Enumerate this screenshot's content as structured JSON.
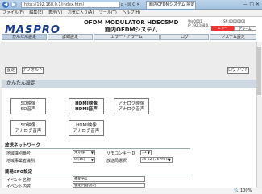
{
  "browser": {
    "back_icon": "back-arrow-icon",
    "forward_icon": "forward-arrow-icon",
    "address": "http://192.168.0.1/index.html",
    "address_controls": "ρ - ☒ C ✕",
    "tab_title": "館内OFDMシステム 設定",
    "window_controls": "— □ ✕"
  },
  "menu": [
    "ファイル(F)",
    "編集(E)",
    "表示(V)",
    "お気に入り(A)",
    "ツール(T)",
    "ヘルプ(H)"
  ],
  "header": {
    "logo": "MASPRO",
    "product_line1": "OFDM MODULATOR HDEC5MD",
    "product_line2": "館内OFDMシステム",
    "version": "Ver.0001\nIP 192.168.0.1",
    "serial": "SN:00000000",
    "error_badge": "エラー",
    "alarm_badge": "アラーム",
    "nav_tabs": [
      "かんたん設定",
      "詳細設定",
      "エラー・アラーム",
      "ログ",
      "システム設定"
    ]
  },
  "toolbar": {
    "settings_label": "設定",
    "default_label": "デフォルト",
    "logout_label": "ログアウト"
  },
  "section_title": "かんたん設定",
  "sources": [
    {
      "line1": "SD映像",
      "line2": "SD音声",
      "bold": false
    },
    {
      "line1": "HDMI映像",
      "line2": "HDMI音声",
      "bold": true
    },
    {
      "line1": "アナログ映像",
      "line2": "アナログ音声",
      "bold": false
    },
    {
      "line1": "SD映像",
      "line2": "アナログ音声",
      "bold": false
    },
    {
      "line1": "HDMI映像",
      "line2": "アナログ音声",
      "bold": false
    }
  ],
  "network": {
    "title": "放送ネットワーク",
    "region_label": "地域識別番号",
    "region_value": "東京都",
    "remote_label": "リモコンキーID",
    "remote_value": "11",
    "operator_label": "地域事業者識別",
    "operator_value": "0 (16)",
    "channel_label": "放送局選択",
    "channel_value": "ch 62 (767MHz)"
  },
  "epg": {
    "title": "簡易EPG設定",
    "event_name_label": "イベント名称",
    "event_name_value": "番組名1",
    "event_content_label": "イベント内容",
    "event_content_value": "番組内容説明"
  },
  "status": {
    "zoom": "100%"
  }
}
